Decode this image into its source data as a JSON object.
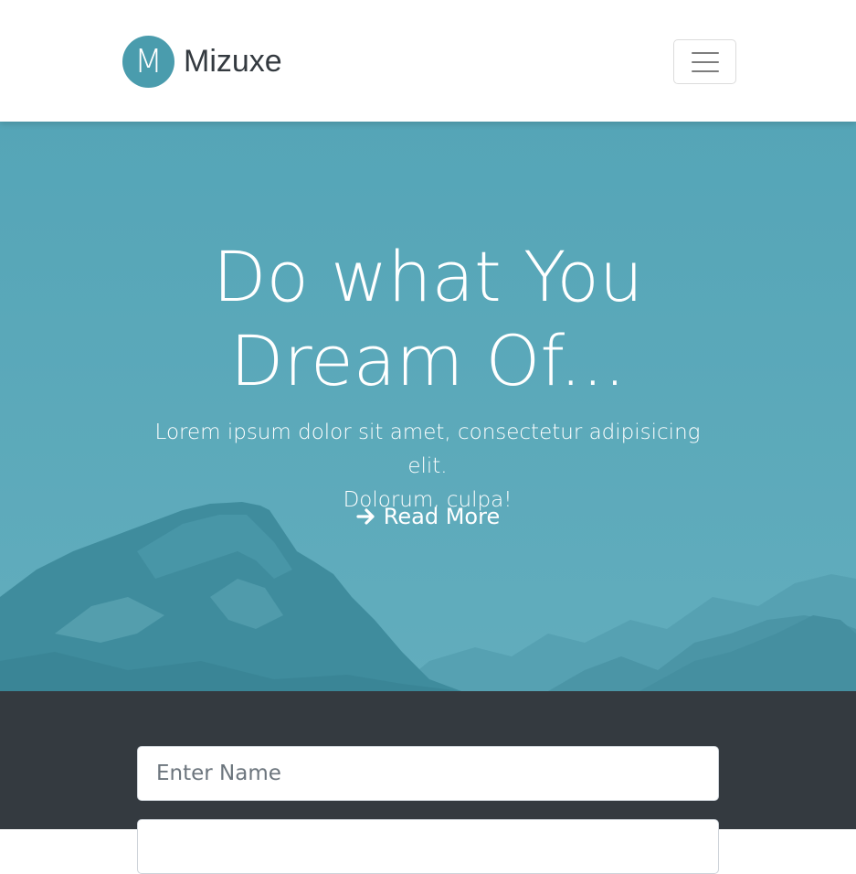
{
  "colors": {
    "brand": "#4a9cad",
    "hero_overlay": "#5aa8b8",
    "dark_section": "#343a40"
  },
  "navbar": {
    "logo_letter": "M",
    "brand_name": "Mizuxe",
    "toggle_icon": "hamburger-icon"
  },
  "hero": {
    "title_line1": "Do what You",
    "title_line2": "Dream Of...",
    "text_line1": "Lorem ipsum dolor sit amet, consectetur adipisicing elit.",
    "text_line2": "Dolorum, culpa!",
    "cta_icon": "arrow-right-icon",
    "cta_label": "Read More"
  },
  "form": {
    "name_placeholder": "Enter Name",
    "email_placeholder": ""
  }
}
